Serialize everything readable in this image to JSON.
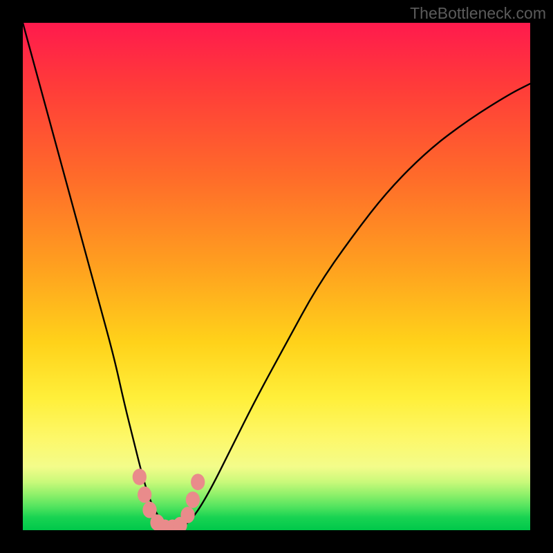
{
  "watermark": "TheBottleneck.com",
  "colors": {
    "frame": "#000000",
    "gradient_top": "#ff1a4d",
    "gradient_bottom": "#00c84a",
    "curve": "#000000",
    "marker": "#e98b8b"
  },
  "chart_data": {
    "type": "line",
    "title": "",
    "xlabel": "",
    "ylabel": "",
    "x_range": [
      0,
      100
    ],
    "y_range": [
      0,
      100
    ],
    "series": [
      {
        "name": "bottleneck-curve",
        "x": [
          0,
          3,
          6,
          9,
          12,
          15,
          18,
          20,
          22,
          23.5,
          25,
          26.5,
          28,
          29,
          30,
          31,
          32,
          34,
          37,
          41,
          46,
          52,
          58,
          65,
          72,
          80,
          88,
          96,
          100
        ],
        "y": [
          100,
          89,
          78,
          67,
          56,
          45,
          34,
          25,
          17,
          11,
          6,
          3,
          1,
          0,
          0,
          0,
          1,
          3,
          8,
          16,
          26,
          37,
          48,
          58,
          67,
          75,
          81,
          86,
          88
        ]
      }
    ],
    "markers": [
      {
        "x": 23.0,
        "y": 10.5
      },
      {
        "x": 24.0,
        "y": 7.0
      },
      {
        "x": 25.0,
        "y": 4.0
      },
      {
        "x": 26.5,
        "y": 1.5
      },
      {
        "x": 28.0,
        "y": 0.5
      },
      {
        "x": 29.5,
        "y": 0.5
      },
      {
        "x": 31.0,
        "y": 1.0
      },
      {
        "x": 32.5,
        "y": 3.0
      },
      {
        "x": 33.5,
        "y": 6.0
      },
      {
        "x": 34.5,
        "y": 9.5
      }
    ],
    "marker_radius": 1.2
  }
}
